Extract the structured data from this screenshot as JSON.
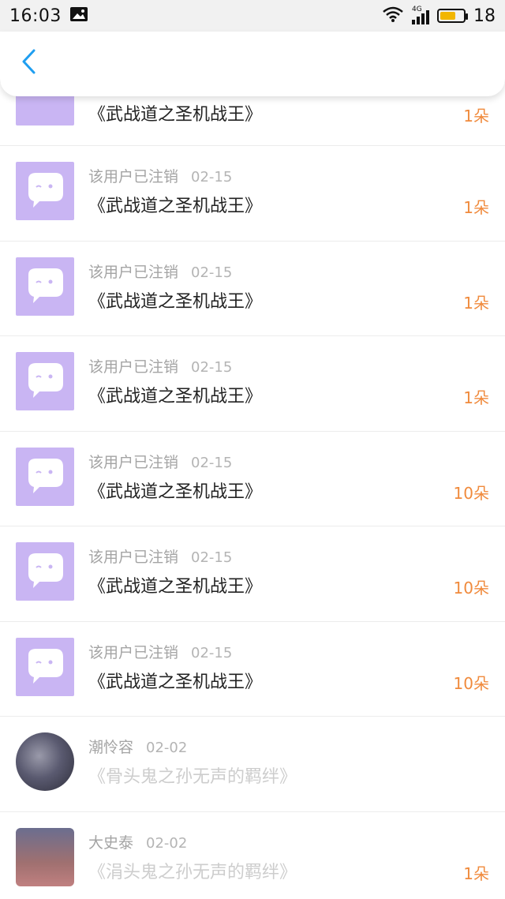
{
  "status_bar": {
    "time": "16:03",
    "network": "4G",
    "battery": "18",
    "battery_level": 0.18
  },
  "header": {
    "back_icon": "chevron-left-icon",
    "accent": "#1f9ef0"
  },
  "colors": {
    "amount": "#f08a3c",
    "avatar_default": "#c9b5f3"
  },
  "rows": [
    {
      "user": "",
      "date": "",
      "title": "《武战道之圣机战王》",
      "amount": "1朵"
    },
    {
      "user": "该用户已注销",
      "date": "02-15",
      "title": "《武战道之圣机战王》",
      "amount": "1朵"
    },
    {
      "user": "该用户已注销",
      "date": "02-15",
      "title": "《武战道之圣机战王》",
      "amount": "1朵"
    },
    {
      "user": "该用户已注销",
      "date": "02-15",
      "title": "《武战道之圣机战王》",
      "amount": "1朵"
    },
    {
      "user": "该用户已注销",
      "date": "02-15",
      "title": "《武战道之圣机战王》",
      "amount": "10朵"
    },
    {
      "user": "该用户已注销",
      "date": "02-15",
      "title": "《武战道之圣机战王》",
      "amount": "10朵"
    },
    {
      "user": "该用户已注销",
      "date": "02-15",
      "title": "《武战道之圣机战王》",
      "amount": "10朵"
    },
    {
      "user": "潮怜容",
      "date": "02-02",
      "title": "《骨头鬼之孙无声的羁绊》",
      "amount": ""
    },
    {
      "user": "大史泰",
      "date": "02-02",
      "title": "《涓头鬼之孙无声的羁绊》",
      "amount": "1朵"
    }
  ]
}
